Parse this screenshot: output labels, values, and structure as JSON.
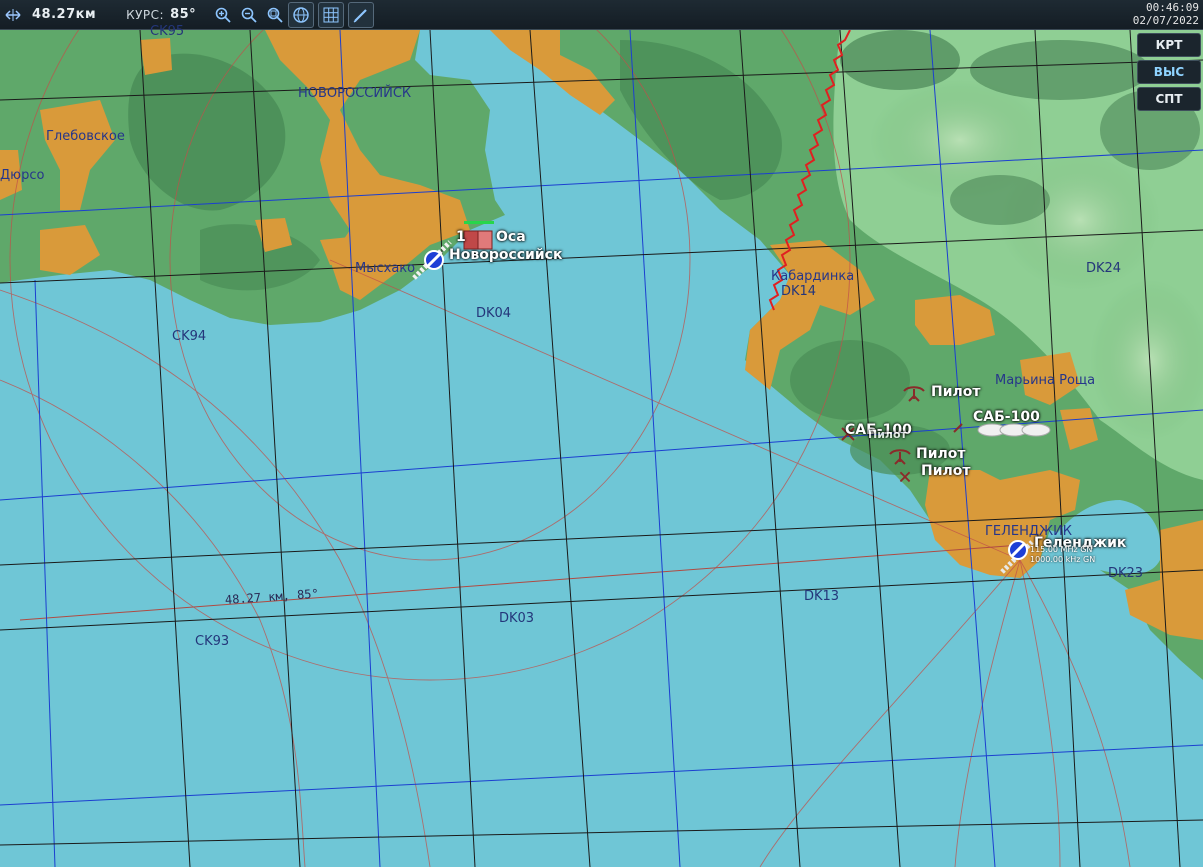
{
  "toolbar": {
    "distance": "48.27км",
    "heading_label": "КУРС:",
    "heading_value": "85°",
    "icons": [
      "ruler-icon",
      "zoom-in-icon",
      "zoom-out-icon",
      "zoom-fit-icon",
      "globe-icon",
      "grid-icon",
      "pencil-icon"
    ]
  },
  "clock": {
    "time": "00:46:09",
    "date": "02/07/2022"
  },
  "layer_buttons": [
    {
      "label": "КРТ",
      "active": false
    },
    {
      "label": "ВЫС",
      "active": true
    },
    {
      "label": "СПТ",
      "active": false
    }
  ],
  "colors": {
    "sea": "#6fc6d6",
    "land": "#5fa86a",
    "urban": "#d99a3a",
    "grid_blue": "#1b3fd0",
    "grid_black": "#1a1a1a",
    "border_red": "#e02020"
  },
  "map": {
    "grid_labels": [
      "CK95",
      "CK94",
      "CK93",
      "DK04",
      "DK03",
      "DK14",
      "DK13",
      "DK24",
      "DK23"
    ],
    "towns": [
      "НОВОРОССИЙСК",
      "Глебовское",
      "Дюрсо",
      "Мысхако",
      "Кабардинка",
      "Марьина Роща",
      "ГЕЛЕНДЖИК"
    ],
    "objects": {
      "airfield_novo": "Новороссийск",
      "airfield_gel": "Геленджик",
      "sam_count": "1",
      "sam_name": "Оса",
      "pilot_1": "Пилот",
      "pilot_2": "Пилот",
      "pilot_3": "Пилот",
      "sab_1": "САБ-100",
      "sab_2": "САБ-100",
      "sab_2_extra": "Пилот",
      "beacon_1": "115.00 MHz GN",
      "beacon_2": "1000.00 kHz GN"
    },
    "measure": "48.27 км, 85°"
  }
}
